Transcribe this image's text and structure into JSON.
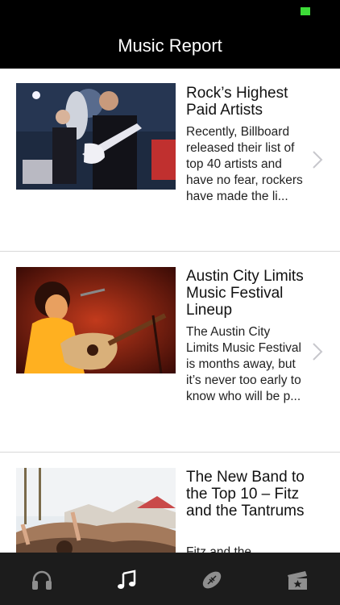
{
  "status_bar": {
    "battery_color": "#3ddc38"
  },
  "nav": {
    "title": "Music Report"
  },
  "articles": [
    {
      "headline": "Rock’s Highest Paid Artists",
      "summary": "Recently, Billboard released their list of top 40 artists and have no fear, rockers have made the li..."
    },
    {
      "headline": "Austin City Limits Music Festival Lineup",
      "summary": "The Austin City Limits Music Festival is months away, but it’s never too early to know who will be p..."
    },
    {
      "headline": "The New Band to the Top 10 – Fitz and the Tantrums",
      "summary": "Fitz and the"
    }
  ],
  "tabs": [
    {
      "icon": "headphones-icon",
      "active": false
    },
    {
      "icon": "music-note-icon",
      "active": true
    },
    {
      "icon": "football-icon",
      "active": false
    },
    {
      "icon": "ticket-star-icon",
      "active": false
    }
  ],
  "colors": {
    "bar_background": "#000000",
    "tab_background": "#1c1c1c",
    "chevron": "#c7c7cc"
  }
}
